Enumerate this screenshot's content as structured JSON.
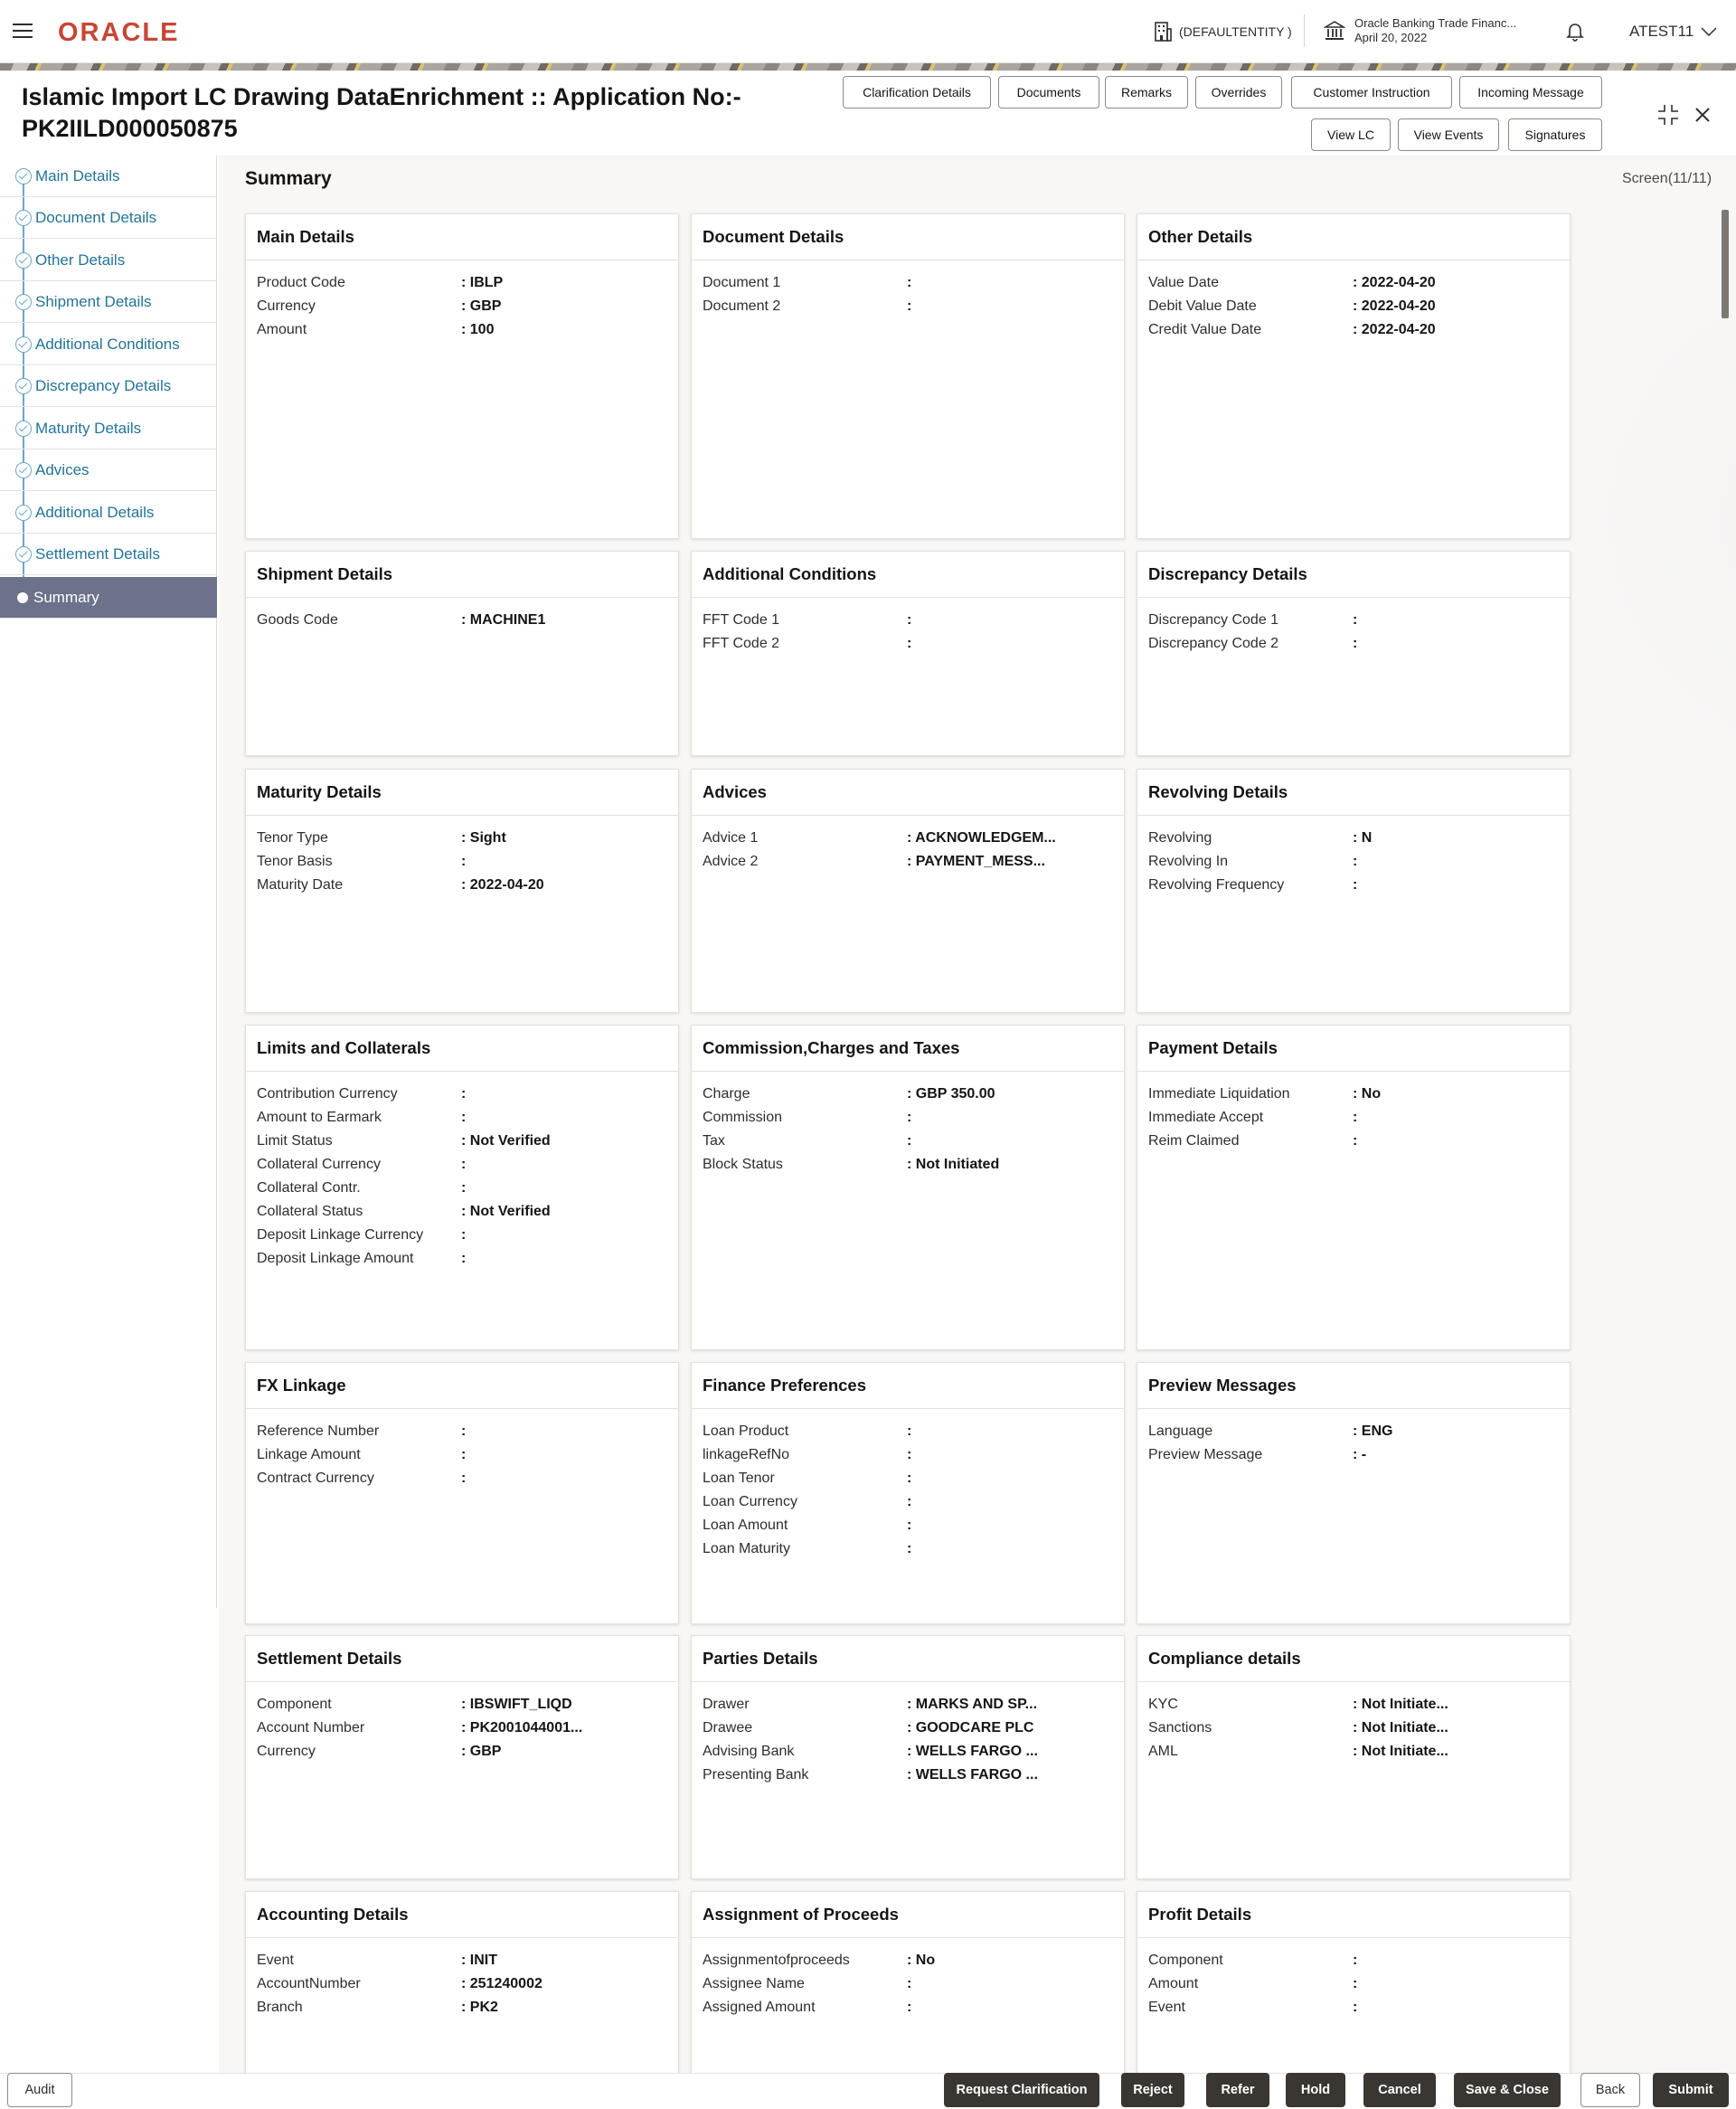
{
  "header": {
    "brand": "ORACLE",
    "entity": "(DEFAULTENTITY )",
    "bank_name": "Oracle Banking Trade Financ...",
    "bank_date": "April 20, 2022",
    "user": "ATEST11"
  },
  "page": {
    "title_line1": "Islamic Import LC Drawing DataEnrichment :: Application No:-",
    "title_line2": "PK2IILD000050875",
    "section_title": "Summary",
    "screen": "Screen(11/11)"
  },
  "toolbar": {
    "row1": [
      "Clarification Details",
      "Documents",
      "Remarks",
      "Overrides",
      "Customer Instruction",
      "Incoming Message"
    ],
    "row2": [
      "View LC",
      "View Events",
      "Signatures"
    ]
  },
  "sidebar": {
    "items": [
      {
        "label": "Main Details"
      },
      {
        "label": "Document Details"
      },
      {
        "label": "Other Details"
      },
      {
        "label": "Shipment Details"
      },
      {
        "label": "Additional Conditions"
      },
      {
        "label": "Discrepancy Details"
      },
      {
        "label": "Maturity Details"
      },
      {
        "label": "Advices"
      },
      {
        "label": "Additional Details"
      },
      {
        "label": "Settlement Details"
      },
      {
        "label": "Summary"
      }
    ]
  },
  "cards": [
    {
      "title": "Main Details",
      "rows": [
        {
          "label": "Product Code",
          "value": ": IBLP"
        },
        {
          "label": "Currency",
          "value": ": GBP"
        },
        {
          "label": "Amount",
          "value": ": 100"
        }
      ]
    },
    {
      "title": "Document Details",
      "rows": [
        {
          "label": "Document 1",
          "value": ":"
        },
        {
          "label": "Document 2",
          "value": ":"
        }
      ]
    },
    {
      "title": "Other Details",
      "rows": [
        {
          "label": "Value Date",
          "value": ": 2022-04-20"
        },
        {
          "label": "Debit Value Date",
          "value": ": 2022-04-20"
        },
        {
          "label": "Credit Value Date",
          "value": ": 2022-04-20"
        }
      ]
    },
    {
      "title": "Shipment Details",
      "rows": [
        {
          "label": "Goods Code",
          "value": ": MACHINE1"
        }
      ]
    },
    {
      "title": "Additional Conditions",
      "rows": [
        {
          "label": "FFT Code 1",
          "value": ":"
        },
        {
          "label": "FFT Code 2",
          "value": ":"
        }
      ]
    },
    {
      "title": "Discrepancy Details",
      "rows": [
        {
          "label": "Discrepancy Code 1",
          "value": ":"
        },
        {
          "label": "Discrepancy Code 2",
          "value": ":"
        }
      ]
    },
    {
      "title": "Maturity Details",
      "rows": [
        {
          "label": "Tenor Type",
          "value": ": Sight"
        },
        {
          "label": "Tenor Basis",
          "value": ":"
        },
        {
          "label": "Maturity Date",
          "value": ": 2022-04-20"
        }
      ]
    },
    {
      "title": "Advices",
      "rows": [
        {
          "label": "Advice 1",
          "value": ": ACKNOWLEDGEM..."
        },
        {
          "label": "Advice 2",
          "value": ": PAYMENT_MESS..."
        }
      ]
    },
    {
      "title": "Revolving Details",
      "rows": [
        {
          "label": "Revolving",
          "value": ": N"
        },
        {
          "label": "Revolving In",
          "value": ":"
        },
        {
          "label": "Revolving Frequency",
          "value": ":"
        }
      ]
    },
    {
      "title": "Limits and Collaterals",
      "rows": [
        {
          "label": "Contribution Currency",
          "value": ":"
        },
        {
          "label": "Amount to Earmark",
          "value": ":"
        },
        {
          "label": "Limit Status",
          "value": ": Not Verified"
        },
        {
          "label": "Collateral Currency",
          "value": ":"
        },
        {
          "label": "Collateral Contr.",
          "value": ":"
        },
        {
          "label": "Collateral Status",
          "value": ": Not Verified"
        },
        {
          "label": "Deposit Linkage Currency",
          "value": ":"
        },
        {
          "label": "Deposit Linkage Amount",
          "value": ":"
        }
      ]
    },
    {
      "title": "Commission,Charges and Taxes",
      "rows": [
        {
          "label": "Charge",
          "value": ": GBP  350.00"
        },
        {
          "label": "Commission",
          "value": ":"
        },
        {
          "label": "Tax",
          "value": ":"
        },
        {
          "label": "Block Status",
          "value": ": Not Initiated"
        }
      ]
    },
    {
      "title": "Payment Details",
      "rows": [
        {
          "label": "Immediate Liquidation",
          "value": ": No"
        },
        {
          "label": "Immediate Accept",
          "value": ":"
        },
        {
          "label": "Reim Claimed",
          "value": ":"
        }
      ]
    },
    {
      "title": "FX Linkage",
      "rows": [
        {
          "label": "Reference Number",
          "value": ":"
        },
        {
          "label": "Linkage Amount",
          "value": ":"
        },
        {
          "label": "Contract Currency",
          "value": ":"
        }
      ]
    },
    {
      "title": "Finance Preferences",
      "rows": [
        {
          "label": "Loan Product",
          "value": ":"
        },
        {
          "label": "linkageRefNo",
          "value": ":"
        },
        {
          "label": "Loan Tenor",
          "value": ":"
        },
        {
          "label": "Loan Currency",
          "value": ":"
        },
        {
          "label": "Loan Amount",
          "value": ":"
        },
        {
          "label": "Loan Maturity",
          "value": ":"
        }
      ]
    },
    {
      "title": "Preview Messages",
      "rows": [
        {
          "label": "Language",
          "value": ": ENG"
        },
        {
          "label": "Preview Message",
          "value": ": -"
        }
      ]
    },
    {
      "title": "Settlement Details",
      "rows": [
        {
          "label": "Component",
          "value": ": IBSWIFT_LIQD"
        },
        {
          "label": "Account Number",
          "value": ": PK2001044001..."
        },
        {
          "label": "Currency",
          "value": ": GBP"
        }
      ]
    },
    {
      "title": "Parties Details",
      "rows": [
        {
          "label": "Drawer",
          "value": ": MARKS AND SP..."
        },
        {
          "label": "Drawee",
          "value": ": GOODCARE PLC"
        },
        {
          "label": "Advising Bank",
          "value": ": WELLS FARGO ..."
        },
        {
          "label": "Presenting Bank",
          "value": ": WELLS FARGO ..."
        }
      ]
    },
    {
      "title": "Compliance details",
      "rows": [
        {
          "label": "KYC",
          "value": ": Not Initiate..."
        },
        {
          "label": "Sanctions",
          "value": ": Not Initiate..."
        },
        {
          "label": "AML",
          "value": ": Not Initiate..."
        }
      ]
    },
    {
      "title": "Accounting Details",
      "rows": [
        {
          "label": "Event",
          "value": ": INIT"
        },
        {
          "label": "AccountNumber",
          "value": ": 251240002"
        },
        {
          "label": "Branch",
          "value": ": PK2"
        }
      ]
    },
    {
      "title": "Assignment of Proceeds",
      "rows": [
        {
          "label": "Assignmentofproceeds",
          "value": ": No"
        },
        {
          "label": "Assignee Name",
          "value": ":"
        },
        {
          "label": "Assigned Amount",
          "value": ":"
        }
      ]
    },
    {
      "title": "Profit Details",
      "rows": [
        {
          "label": "Component",
          "value": ":"
        },
        {
          "label": "Amount",
          "value": ":"
        },
        {
          "label": "Event",
          "value": ":"
        }
      ]
    }
  ],
  "footer": {
    "audit": "Audit",
    "actions": [
      "Request Clarification",
      "Reject",
      "Refer",
      "Hold",
      "Cancel",
      "Save & Close"
    ],
    "back": "Back",
    "submit": "Submit"
  }
}
